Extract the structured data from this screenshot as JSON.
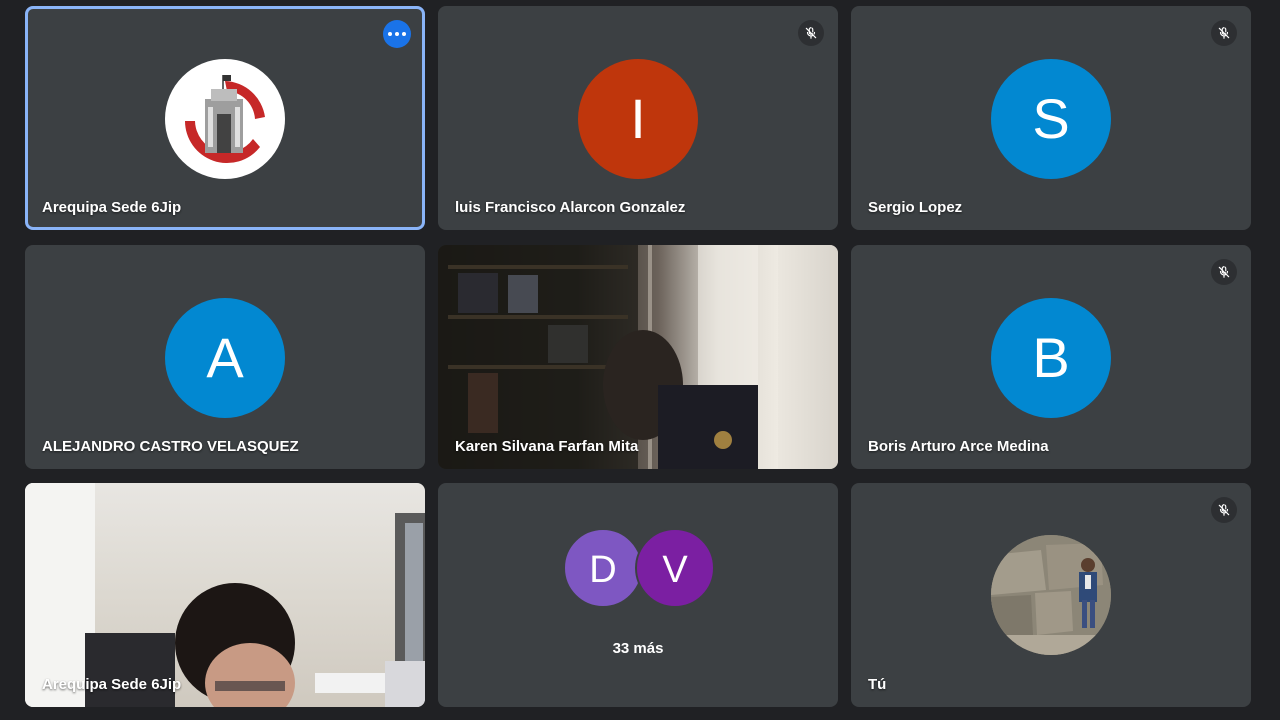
{
  "tiles": [
    {
      "name": "Arequipa Sede 6Jip",
      "type": "logo",
      "muted": false,
      "more_options": true
    },
    {
      "name": "luis Francisco Alarcon Gonzalez",
      "type": "initial",
      "initial": "I",
      "color": "#bf360c",
      "muted": true
    },
    {
      "name": "Sergio Lopez",
      "type": "initial",
      "initial": "S",
      "color": "#0288d1",
      "muted": true
    },
    {
      "name": "ALEJANDRO CASTRO VELASQUEZ",
      "type": "initial",
      "initial": "A",
      "color": "#0288d1",
      "muted": false
    },
    {
      "name": "Karen Silvana Farfan Mita",
      "type": "video",
      "muted": false
    },
    {
      "name": "Boris Arturo Arce Medina",
      "type": "initial",
      "initial": "B",
      "color": "#0288d1",
      "muted": true
    },
    {
      "name": "Arequipa Sede 6Jip",
      "type": "video",
      "muted": false
    },
    {
      "type": "overflow",
      "avatars": [
        {
          "initial": "D",
          "color": "#7e57c2"
        },
        {
          "initial": "V",
          "color": "#7b1fa2"
        }
      ],
      "more_label": "33 más"
    },
    {
      "name": "Tú",
      "type": "photo",
      "muted": true
    }
  ],
  "icons": {
    "mute": "mic-off-icon",
    "more": "more-horiz-icon"
  }
}
